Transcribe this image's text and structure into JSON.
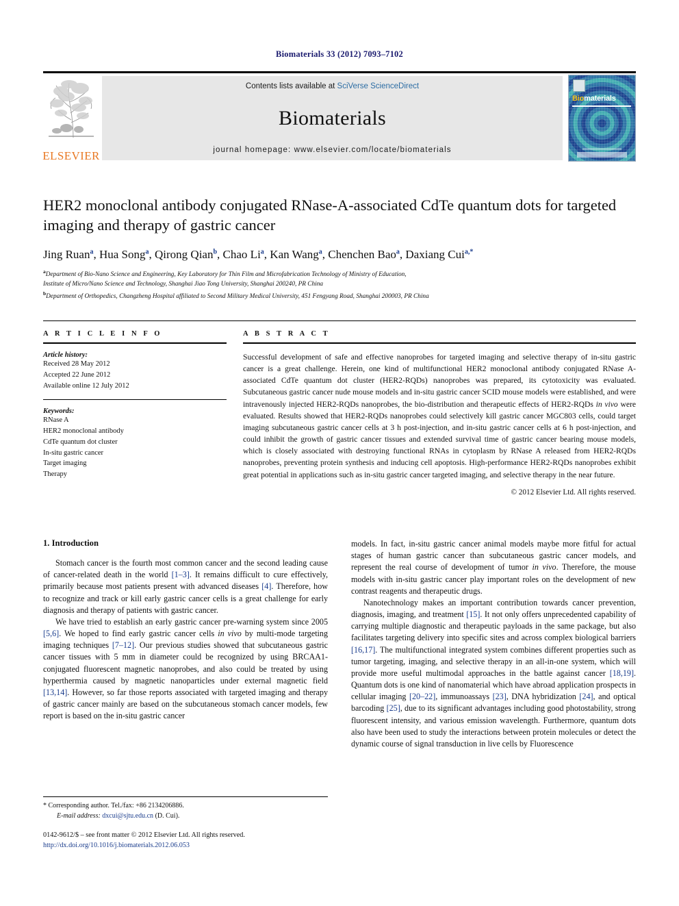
{
  "running_head": "Biomaterials 33 (2012) 7093–7102",
  "masthead": {
    "contents_prefix": "Contents lists available at ",
    "contents_link": "SciVerse ScienceDirect",
    "journal_name": "Biomaterials",
    "homepage_prefix": "journal homepage: ",
    "homepage_url": "www.elsevier.com/locate/biomaterials",
    "publisher_wordmark": "ELSEVIER",
    "cover": {
      "title_part1": "Bio",
      "title_part2": "materials"
    }
  },
  "article": {
    "title": "HER2 monoclonal antibody conjugated RNase-A-associated CdTe quantum dots for targeted imaging and therapy of gastric cancer",
    "authors_html": "Jing Ruan<sup>a</sup>, Hua Song<sup>a</sup>, Qirong Qian<sup>b</sup>, Chao Li<sup>a</sup>, Kan Wang<sup>a</sup>, Chenchen Bao<sup>a</sup>, Daxiang Cui<sup>a,*</sup>",
    "affiliation_a_line1": "Department of Bio-Nano Science and Engineering, Key Laboratory for Thin Film and Microfabrication Technology of Ministry of Education,",
    "affiliation_a_line2": "Institute of Micro/Nano Science and Technology, Shanghai Jiao Tong University, Shanghai 200240, PR China",
    "affiliation_b": "Department of Orthopedics, Changzheng Hospital affiliated to Second Military Medical University, 451 Fengyang Road, Shanghai 200003, PR China",
    "affiliation_a_marker": "a",
    "affiliation_b_marker": "b"
  },
  "article_info": {
    "heading": "A R T I C L E   I N F O",
    "history_title": "Article history:",
    "history": [
      "Received 28 May 2012",
      "Accepted 22 June 2012",
      "Available online 12 July 2012"
    ],
    "keywords_title": "Keywords:",
    "keywords": [
      "RNase A",
      "HER2 monoclonal antibody",
      "CdTe quantum dot cluster",
      "In-situ gastric cancer",
      "Target imaging",
      "Therapy"
    ]
  },
  "abstract": {
    "heading": "A B S T R A C T",
    "text_html": "Successful development of safe and effective nanoprobes for targeted imaging and selective therapy of in-situ gastric cancer is a great challenge. Herein, one kind of multifunctional HER2 monoclonal antibody conjugated RNase A-associated CdTe quantum dot cluster (HER2-RQDs) nanoprobes was prepared, its cytotoxicity was evaluated. Subcutaneous gastric cancer nude mouse models and in-situ gastric cancer SCID mouse models were established, and were intravenously injected HER2-RQDs nanoprobes, the bio-distribution and therapeutic effects of HER2-RQDs <i>in vivo</i> were evaluated. Results showed that HER2-RQDs nanoprobes could selectively kill gastric cancer MGC803 cells, could target imaging subcutaneous gastric cancer cells at 3 h post-injection, and in-situ gastric cancer cells at 6 h post-injection, and could inhibit the growth of gastric cancer tissues and extended survival time of gastric cancer bearing mouse models, which is closely associated with destroying functional RNAs in cytoplasm by RNase A released from HER2-RQDs nanoprobes, preventing protein synthesis and inducing cell apoptosis. High-performance HER2-RQDs nanoprobes exhibit great potential in applications such as in-situ gastric cancer targeted imaging, and selective therapy in the near future.",
    "copyright": "© 2012 Elsevier Ltd. All rights reserved."
  },
  "body": {
    "section_heading": "1. Introduction",
    "left_paragraphs_html": [
      "Stomach cancer is the fourth most common cancer and the second leading cause of cancer-related death in the world <span class=\"ref\">[1–3]</span>. It remains difficult to cure effectively, primarily because most patients present with advanced diseases <span class=\"ref\">[4]</span>. Therefore, how to recognize and track or kill early gastric cancer cells is a great challenge for early diagnosis and therapy of patients with gastric cancer.",
      "We have tried to establish an early gastric cancer pre-warning system since 2005 <span class=\"ref\">[5,6]</span>. We hoped to find early gastric cancer cells <i>in vivo</i> by multi-mode targeting imaging techniques <span class=\"ref\">[7–12]</span>. Our previous studies showed that subcutaneous gastric cancer tissues with 5 mm in diameter could be recognized by using BRCAA1-conjugated fluorescent magnetic nanoprobes, and also could be treated by using hyperthermia caused by magnetic nanoparticles under external magnetic field <span class=\"ref\">[13,14]</span>. However, so far those reports associated with targeted imaging and therapy of gastric cancer mainly are based on the subcutaneous stomach cancer models, few report is based on the in-situ gastric cancer"
    ],
    "right_paragraphs_html": [
      "models. In fact, in-situ gastric cancer animal models maybe more fitful for actual stages of human gastric cancer than subcutaneous gastric cancer models, and represent the real course of development of tumor <i>in vivo</i>. Therefore, the mouse models with in-situ gastric cancer play important roles on the development of new contrast reagents and therapeutic drugs.",
      "Nanotechnology makes an important contribution towards cancer prevention, diagnosis, imaging, and treatment <span class=\"ref\">[15]</span>. It not only offers unprecedented capability of carrying multiple diagnostic and therapeutic payloads in the same package, but also facilitates targeting delivery into specific sites and across complex biological barriers <span class=\"ref\">[16,17]</span>. The multifunctional integrated system combines different properties such as tumor targeting, imaging, and selective therapy in an all-in-one system, which will provide more useful multimodal approaches in the battle against cancer <span class=\"ref\">[18,19]</span>. Quantum dots is one kind of nanomaterial which have abroad application prospects in cellular imaging <span class=\"ref\">[20–22]</span>, immunoassays <span class=\"ref\">[23]</span>, DNA hybridization <span class=\"ref\">[24]</span>, and optical barcoding <span class=\"ref\">[25]</span>, due to its significant advantages including good photostability, strong fluorescent intensity, and various emission wavelength. Furthermore, quantum dots also have been used to study the interactions between protein molecules or detect the dynamic course of signal transduction in live cells by Fluorescence"
    ]
  },
  "footnote": {
    "corresponding_html": "* Corresponding author. Tel./fax: +86 2134206886.",
    "email_html": "<span class=\"em-italic\">E-mail address:</span> <span class=\"email\">dxcui@sjtu.edu.cn</span> (D. Cui)."
  },
  "footer": {
    "issn_line": "0142-9612/$ – see front matter © 2012 Elsevier Ltd. All rights reserved.",
    "doi": "http://dx.doi.org/10.1016/j.biomaterials.2012.06.053"
  },
  "colors": {
    "running_head": "#1a1a6e",
    "link_blue": "#1a3c8c",
    "sciencedirect_blue": "#2b6ca3",
    "elsevier_orange": "#E87722",
    "band_gray": "#e7e7e7"
  }
}
